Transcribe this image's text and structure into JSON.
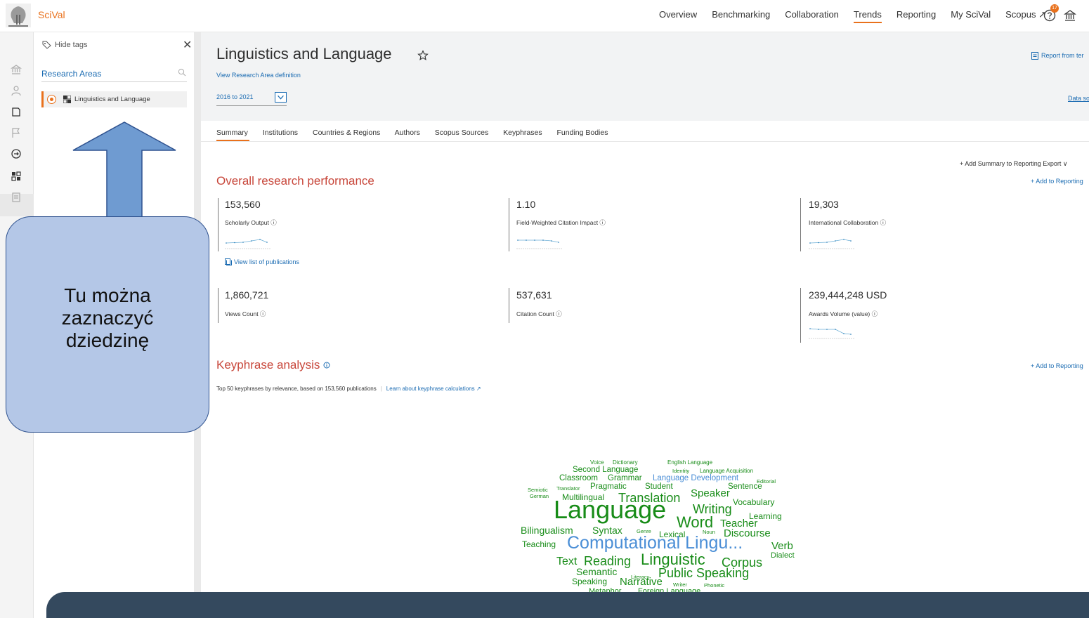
{
  "app": {
    "brand": "SciVal"
  },
  "nav": {
    "items": [
      "Overview",
      "Benchmarking",
      "Collaboration",
      "Trends",
      "Reporting",
      "My SciVal",
      "Scopus ↗"
    ],
    "active": "Trends",
    "help_badge": "17"
  },
  "panel": {
    "hide_tags": "Hide tags",
    "close": "✕",
    "research_areas_title": "Research Areas",
    "selected_item": "Linguistics and Language"
  },
  "header": {
    "title": "Linguistics and Language",
    "definition_link": "View Research Area definition",
    "year_range": "2016 to 2021",
    "report_link": "Report from ter",
    "data_source": "Data so"
  },
  "tabs": [
    "Summary",
    "Institutions",
    "Countries & Regions",
    "Authors",
    "Scopus Sources",
    "Keyphrases",
    "Funding Bodies"
  ],
  "actions": {
    "add_summary": "+ Add Summary to Reporting   Export ∨",
    "add_to_reporting": "+ Add to Reporting"
  },
  "performance": {
    "title": "Overall research performance",
    "metrics": [
      {
        "value": "153,560",
        "label": "Scholarly Output ⓘ"
      },
      {
        "value": "1.10",
        "label": "Field-Weighted Citation Impact ⓘ"
      },
      {
        "value": "19,303",
        "label": "International Collaboration ⓘ"
      },
      {
        "value": "1,860,721",
        "label": "Views Count ⓘ"
      },
      {
        "value": "537,631",
        "label": "Citation Count ⓘ"
      },
      {
        "value": "239,444,248 USD",
        "label": "Awards Volume (value) ⓘ"
      }
    ],
    "publications_link": "View list of publications"
  },
  "keyphrases": {
    "title": "Keyphrase analysis",
    "subtitle": "Top 50 keyphrases by relevance, based on 153,560 publications",
    "learn_link": "Learn about keyphrase calculations ↗",
    "words": [
      "Voice",
      "Dictionary",
      "English Language",
      "Second Language",
      "Identity",
      "Language Acquisition",
      "Classroom",
      "Grammar",
      "Language Development",
      "Editorial",
      "Semiotic",
      "Translator",
      "Pragmatic",
      "Student",
      "Sentence",
      "German",
      "Multilingual",
      "Translation",
      "Speaker",
      "Vocabulary",
      "Language",
      "Writing",
      "Learning",
      "Word",
      "Teacher",
      "Bilingualism",
      "Syntax",
      "Genre",
      "Lexical",
      "Noun",
      "Discourse",
      "Teaching",
      "Computational Lingu...",
      "Verb",
      "Dialect",
      "Text",
      "Reading",
      "Linguistic",
      "Corpus",
      "Semantic",
      "Literacy",
      "Public Speaking",
      "Speaking",
      "Narrative",
      "Writer",
      "Phonetic",
      "Metaphor",
      "Foreign Language"
    ]
  },
  "annotation": {
    "callout": "Tu można\nzaznaczyć\n dziedzinę"
  }
}
